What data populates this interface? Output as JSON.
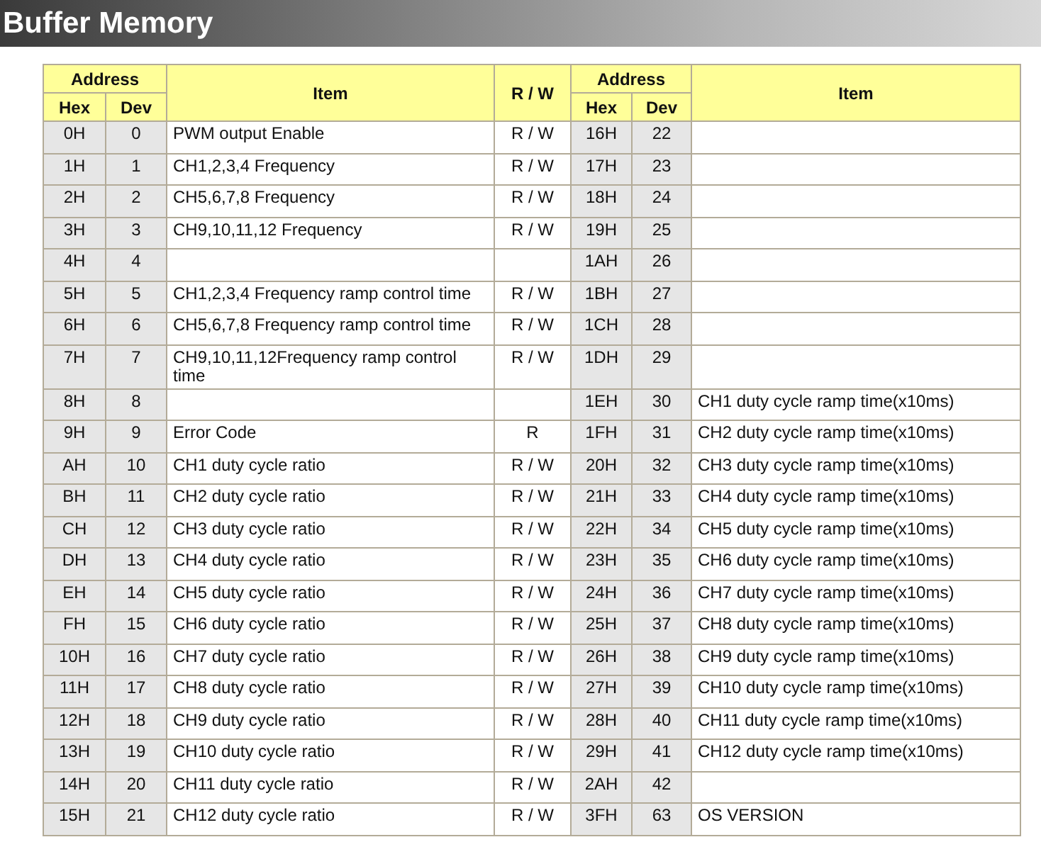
{
  "title": "Buffer Memory",
  "table": {
    "header": {
      "left": {
        "group": "Address",
        "hex": "Hex",
        "dev": "Dev",
        "item": "Item"
      },
      "rw": "R / W",
      "right": {
        "group": "Address",
        "hex": "Hex",
        "dev": "Dev",
        "item": "Item"
      }
    },
    "rows": [
      {
        "left": {
          "hex": "0H",
          "dev": "0",
          "item": "PWM output Enable",
          "rw": "R / W"
        },
        "right": {
          "hex": "16H",
          "dev": "22"
        }
      },
      {
        "left": {
          "hex": "1H",
          "dev": "1",
          "item": "CH1,2,3,4 Frequency",
          "rw": "R / W"
        },
        "right": {
          "hex": "17H",
          "dev": "23"
        }
      },
      {
        "left": {
          "hex": "2H",
          "dev": "2",
          "item": "CH5,6,7,8 Frequency",
          "rw": "R / W"
        },
        "right": {
          "hex": "18H",
          "dev": "24"
        }
      },
      {
        "left": {
          "hex": "3H",
          "dev": "3",
          "item": "CH9,10,11,12 Frequency",
          "rw": "R / W"
        },
        "right": {
          "hex": "19H",
          "dev": "25"
        }
      },
      {
        "left": {
          "hex": "4H",
          "dev": "4"
        },
        "right": {
          "hex": "1AH",
          "dev": "26"
        }
      },
      {
        "left": {
          "hex": "5H",
          "dev": "5",
          "item": "CH1,2,3,4 Frequency ramp control time",
          "rw": "R / W"
        },
        "right": {
          "hex": "1BH",
          "dev": "27"
        }
      },
      {
        "left": {
          "hex": "6H",
          "dev": "6",
          "item": "CH5,6,7,8 Frequency ramp control time",
          "rw": "R / W"
        },
        "right": {
          "hex": "1CH",
          "dev": "28"
        }
      },
      {
        "left": {
          "hex": "7H",
          "dev": "7",
          "item": "CH9,10,11,12Frequency ramp control time",
          "rw": "R / W"
        },
        "right": {
          "hex": "1DH",
          "dev": "29"
        }
      },
      {
        "left": {
          "hex": "8H",
          "dev": "8"
        },
        "right": {
          "hex": "1EH",
          "dev": "30",
          "item": "CH1 duty cycle ramp time(x10ms)"
        }
      },
      {
        "left": {
          "hex": "9H",
          "dev": "9",
          "item": "Error Code",
          "rw": "R"
        },
        "right": {
          "hex": "1FH",
          "dev": "31",
          "item": "CH2 duty cycle ramp time(x10ms)"
        }
      },
      {
        "left": {
          "hex": "AH",
          "dev": "10",
          "item": "CH1 duty cycle ratio",
          "rw": "R / W"
        },
        "right": {
          "hex": "20H",
          "dev": "32",
          "item": "CH3 duty cycle ramp time(x10ms)"
        }
      },
      {
        "left": {
          "hex": "BH",
          "dev": "11",
          "item": "CH2 duty cycle ratio",
          "rw": "R / W"
        },
        "right": {
          "hex": "21H",
          "dev": "33",
          "item": "CH4 duty cycle ramp time(x10ms)"
        }
      },
      {
        "left": {
          "hex": "CH",
          "dev": "12",
          "item": "CH3 duty cycle ratio",
          "rw": "R / W"
        },
        "right": {
          "hex": "22H",
          "dev": "34",
          "item": "CH5 duty cycle ramp time(x10ms)"
        }
      },
      {
        "left": {
          "hex": "DH",
          "dev": "13",
          "item": "CH4 duty cycle ratio",
          "rw": "R / W"
        },
        "right": {
          "hex": "23H",
          "dev": "35",
          "item": "CH6 duty cycle ramp time(x10ms)"
        }
      },
      {
        "left": {
          "hex": "EH",
          "dev": "14",
          "item": "CH5 duty cycle ratio",
          "rw": "R / W"
        },
        "right": {
          "hex": "24H",
          "dev": "36",
          "item": "CH7 duty cycle ramp time(x10ms)"
        }
      },
      {
        "left": {
          "hex": "FH",
          "dev": "15",
          "item": "CH6 duty cycle ratio",
          "rw": "R / W"
        },
        "right": {
          "hex": "25H",
          "dev": "37",
          "item": "CH8 duty cycle ramp time(x10ms)"
        }
      },
      {
        "left": {
          "hex": "10H",
          "dev": "16",
          "item": "CH7 duty cycle ratio",
          "rw": "R / W"
        },
        "right": {
          "hex": "26H",
          "dev": "38",
          "item": "CH9 duty cycle ramp time(x10ms)"
        }
      },
      {
        "left": {
          "hex": "11H",
          "dev": "17",
          "item": "CH8 duty cycle ratio",
          "rw": "R / W"
        },
        "right": {
          "hex": "27H",
          "dev": "39",
          "item": "CH10 duty cycle ramp time(x10ms)"
        }
      },
      {
        "left": {
          "hex": "12H",
          "dev": "18",
          "item": "CH9 duty cycle ratio",
          "rw": "R / W"
        },
        "right": {
          "hex": "28H",
          "dev": "40",
          "item": "CH11 duty cycle ramp time(x10ms)"
        }
      },
      {
        "left": {
          "hex": "13H",
          "dev": "19",
          "item": "CH10 duty cycle ratio",
          "rw": "R / W"
        },
        "right": {
          "hex": "29H",
          "dev": "41",
          "item": "CH12 duty cycle ramp time(x10ms)"
        }
      },
      {
        "left": {
          "hex": "14H",
          "dev": "20",
          "item": "CH11 duty cycle ratio",
          "rw": "R / W"
        },
        "right": {
          "hex": "2AH",
          "dev": "42"
        }
      },
      {
        "left": {
          "hex": "15H",
          "dev": "21",
          "item": "CH12 duty cycle ratio",
          "rw": "R / W"
        },
        "right": {
          "hex": "3FH",
          "dev": "63",
          "item": "OS VERSION"
        }
      }
    ]
  }
}
